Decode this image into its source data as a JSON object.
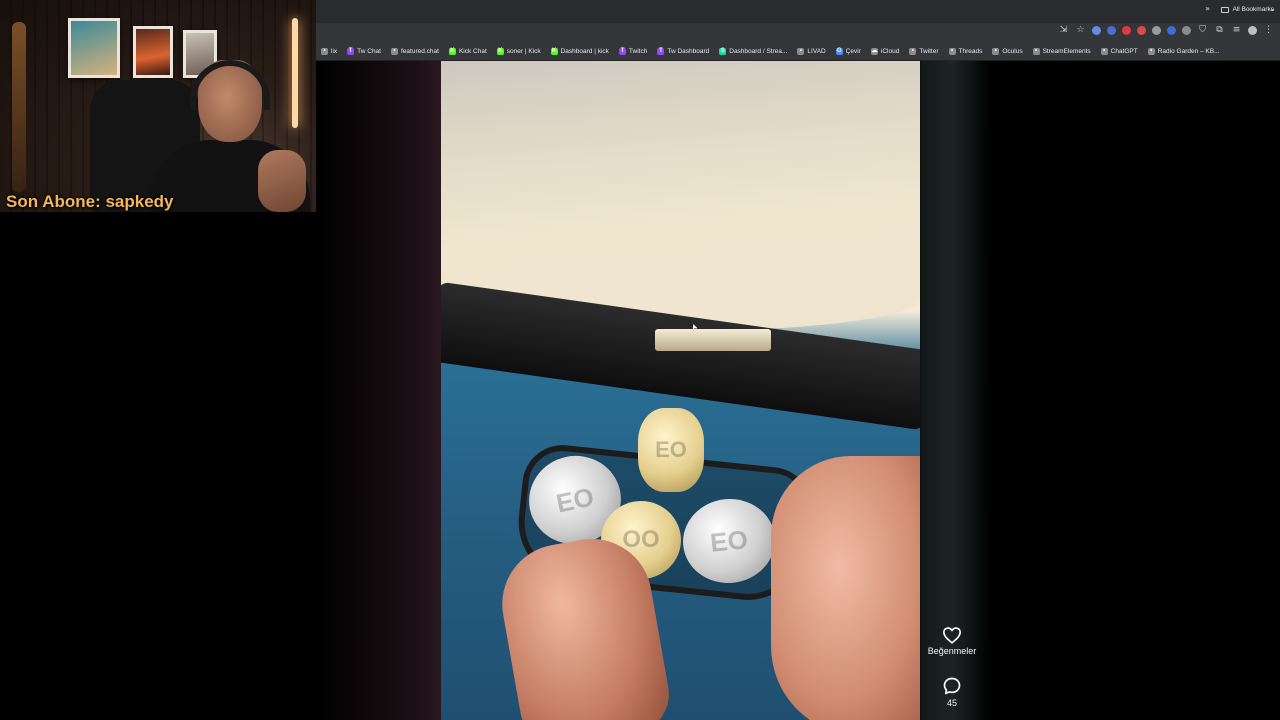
{
  "webcam": {
    "caption": "Son Abone: sapkedy"
  },
  "bookmarks": {
    "items": [
      {
        "label": "lix",
        "icon": "generic-icon",
        "color": "#8c8c8c"
      },
      {
        "label": "Tw Chat",
        "icon": "twitch-icon",
        "color": "#9146ff"
      },
      {
        "label": "featured.chat",
        "icon": "globe-icon",
        "color": "#8c8c8c"
      },
      {
        "label": "Kick Chat",
        "icon": "kick-icon",
        "color": "#53fc18"
      },
      {
        "label": "soner | Kick",
        "icon": "kick-icon",
        "color": "#53fc18"
      },
      {
        "label": "Dashboard | kick",
        "icon": "kick-icon",
        "color": "#53fc18"
      },
      {
        "label": "Twitch",
        "icon": "twitch-icon",
        "color": "#9146ff"
      },
      {
        "label": "Tw Dashboard",
        "icon": "twitch-icon",
        "color": "#9146ff"
      },
      {
        "label": "Dashboard / Strea...",
        "icon": "streamelements-icon",
        "color": "#27d8a3"
      },
      {
        "label": "LIVAD",
        "icon": "globe-icon",
        "color": "#8c8c8c"
      },
      {
        "label": "Çevir",
        "icon": "translate-icon",
        "color": "#4a8af4"
      },
      {
        "label": "iCloud",
        "icon": "cloud-icon",
        "color": "#8c8c8c"
      },
      {
        "label": "Twitter",
        "icon": "globe-icon",
        "color": "#8c8c8c"
      },
      {
        "label": "Threads",
        "icon": "globe-icon",
        "color": "#8c8c8c"
      },
      {
        "label": "Oculus",
        "icon": "globe-icon",
        "color": "#8c8c8c"
      },
      {
        "label": "StreamElements",
        "icon": "globe-icon",
        "color": "#8c8c8c"
      },
      {
        "label": "ChatGPT",
        "icon": "globe-icon",
        "color": "#8c8c8c"
      },
      {
        "label": "Radio Garden – KB...",
        "icon": "globe-icon",
        "color": "#8c8c8c"
      }
    ],
    "all_bookmarks": "All Bookmarks"
  },
  "video": {
    "coins": [
      "EO",
      "EO",
      "OO",
      "EO"
    ]
  },
  "actions": {
    "like_label": "Beğenmeler",
    "comment_count": "45"
  },
  "colors": {
    "caption": "#f2b65c",
    "chrome": "#35363a"
  }
}
